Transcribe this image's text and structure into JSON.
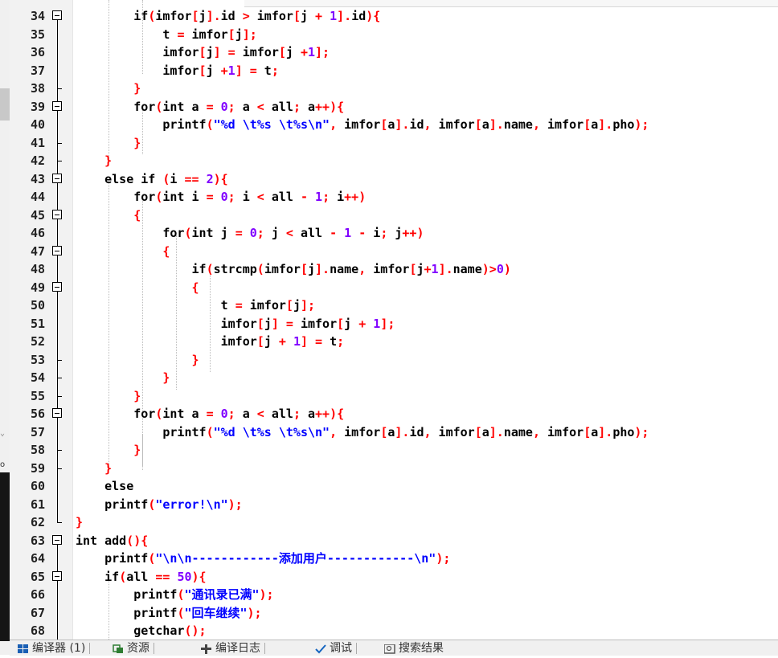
{
  "editor": {
    "line_numbers": [
      "34",
      "35",
      "36",
      "37",
      "38",
      "39",
      "40",
      "41",
      "42",
      "43",
      "44",
      "45",
      "46",
      "47",
      "48",
      "49",
      "50",
      "51",
      "52",
      "53",
      "54",
      "55",
      "56",
      "57",
      "58",
      "59",
      "60",
      "61",
      "62",
      "63",
      "64",
      "65",
      "66",
      "67",
      "68"
    ]
  },
  "bottom_tabs": [
    {
      "label": "编译器 (1)",
      "icon": "compiler-grid-icon"
    },
    {
      "label": "资源",
      "icon": "resource-icon"
    },
    {
      "label": "编译日志",
      "icon": "compile-log-icon"
    },
    {
      "label": "调试",
      "icon": "debug-check-icon"
    },
    {
      "label": "搜索结果",
      "icon": "search-results-icon"
    }
  ],
  "side_fragments": {
    "chevron": "⌄",
    "letter": "o"
  },
  "colors": {
    "keyword": "#000000",
    "symbol": "#ff0000",
    "number": "#8000ff",
    "string": "#0000ff",
    "gutter": "#f2f2f2"
  }
}
